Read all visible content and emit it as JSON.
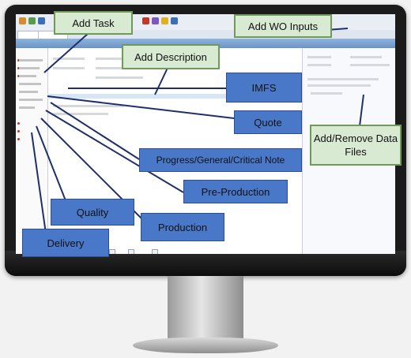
{
  "callouts": {
    "add_task": "Add Task",
    "add_wo_inputs": "Add WO Inputs",
    "add_description": "Add Description",
    "imfs": "IMFS",
    "quote": "Quote",
    "add_remove_data_files": "Add/Remove Data Files",
    "progress_note": "Progress/General/Critical Note",
    "pre_production": "Pre-Production",
    "quality": "Quality",
    "production": "Production",
    "delivery": "Delivery"
  },
  "colors": {
    "green_fill": "#d9ead3",
    "green_border": "#6f9a5a",
    "blue_fill": "#4a78c8",
    "line_color": "#1f2f6e"
  }
}
